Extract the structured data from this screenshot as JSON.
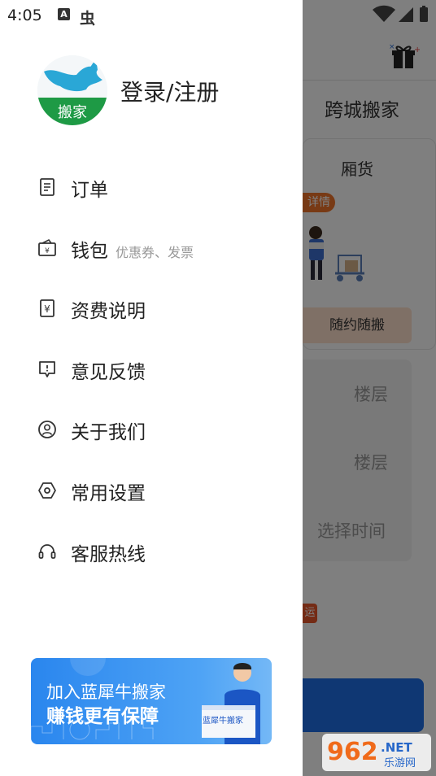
{
  "status_bar": {
    "time": "4:05",
    "a_icon": "A",
    "bug_icon": "虫",
    "icons": [
      "wifi-icon",
      "signal-icon",
      "battery-icon"
    ]
  },
  "drawer": {
    "login_label": "登录/注册",
    "avatar_text": "搬家",
    "menu": [
      {
        "label": "订单",
        "icon": "order-icon"
      },
      {
        "label": "钱包",
        "sub": "优惠券、发票",
        "icon": "wallet-icon"
      },
      {
        "label": "资费说明",
        "icon": "fee-icon"
      },
      {
        "label": "意见反馈",
        "icon": "feedback-icon"
      },
      {
        "label": "关于我们",
        "icon": "about-icon"
      },
      {
        "label": "常用设置",
        "icon": "settings-icon"
      },
      {
        "label": "客服热线",
        "icon": "headset-icon"
      }
    ],
    "promo": {
      "line1": "加入蓝犀牛搬家",
      "line2": "赚钱更有保障",
      "box_text": "蓝犀牛搬家"
    }
  },
  "background": {
    "tab_label": "跨城搬家",
    "van_label": "厢货",
    "detail_badge": "详情",
    "anytime_button": "随约随搬",
    "floor_1": "楼层",
    "floor_2": "楼层",
    "select_time": "选择时间",
    "red_badge": "运"
  },
  "watermark": {
    "text_962": "962",
    "text_net": ".NET",
    "text_site": "乐游网"
  },
  "colors": {
    "brand_blue": "#1f6fe6",
    "logo_teal": "#2aa7d6",
    "logo_green": "#1e9a45",
    "accent_orange": "#f0742b"
  }
}
